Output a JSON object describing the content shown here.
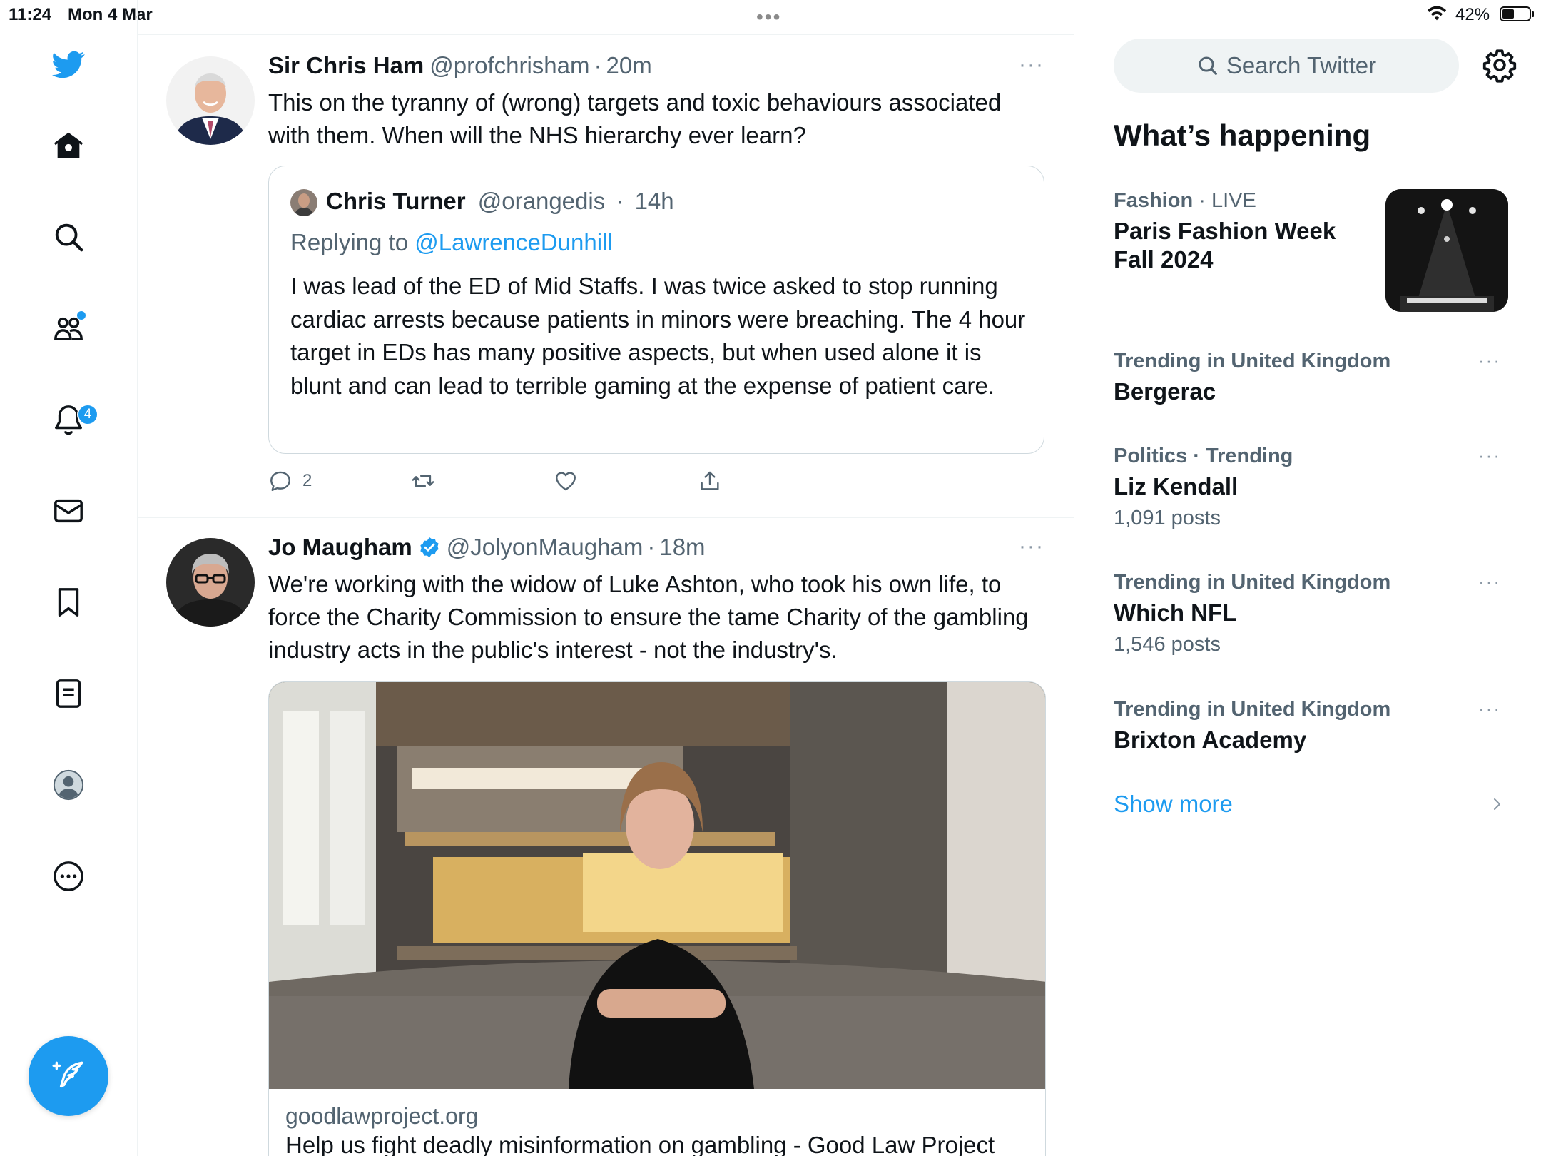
{
  "status_bar": {
    "time": "11:24",
    "date": "Mon 4 Mar",
    "battery_percent": "42%",
    "battery_level": 0.42
  },
  "nav": {
    "items": [
      {
        "name": "home",
        "icon": "home-icon"
      },
      {
        "name": "explore",
        "icon": "search-icon"
      },
      {
        "name": "communities",
        "icon": "communities-icon"
      },
      {
        "name": "notifications",
        "icon": "bell-icon"
      },
      {
        "name": "messages",
        "icon": "mail-icon"
      },
      {
        "name": "bookmarks",
        "icon": "bookmark-icon"
      },
      {
        "name": "lists",
        "icon": "list-icon"
      },
      {
        "name": "profile",
        "icon": "profile-icon"
      },
      {
        "name": "more",
        "icon": "more-circle-icon"
      }
    ],
    "notifications_badge": "4",
    "compose_icon": "compose-feather-icon"
  },
  "tweets": [
    {
      "name": "Sir Chris Ham",
      "handle": "@profchrisham",
      "sep": "·",
      "time": "20m",
      "more": "···",
      "text": "This on the tyranny of (wrong) targets and toxic behaviours associated with them. When will the NHS hierarchy ever learn?",
      "quote": {
        "name": "Chris Turner",
        "handle": "@orangedis",
        "sep": "·",
        "time": "14h",
        "replying_label": "Replying to",
        "replying_to": "@LawrenceDunhill",
        "text": "I was lead of the ED of Mid Staffs. I was twice asked to stop running cardiac arrests because patients in minors were breaching. The 4 hour target in EDs has many positive aspects, but when used alone it is blunt and can lead to terrible gaming at the expense of patient care."
      },
      "reply_count": "2"
    },
    {
      "name": "Jo Maugham",
      "handle": "@JolyonMaugham",
      "sep": "·",
      "time": "18m",
      "more": "···",
      "verified": true,
      "text": "We're working with the widow of Luke Ashton, who took his own life, to force the Charity Commission to ensure the tame Charity of the gambling industry acts in the public's interest - not the industry's.",
      "card": {
        "domain": "goodlawproject.org",
        "title": "Help us fight deadly misinformation on gambling - Good Law Project"
      }
    }
  ],
  "sidebar": {
    "search_placeholder": "Search Twitter",
    "whats_happening": "What’s happening",
    "trends": [
      {
        "category": "Fashion",
        "sep": "·",
        "status": "LIVE",
        "title": "Paris Fashion Week Fall 2024"
      },
      {
        "category": "Trending in United Kingdom",
        "title": "Bergerac",
        "more": "···"
      },
      {
        "category": "Politics",
        "sep": "·",
        "status": "Trending",
        "title": "Liz Kendall",
        "count": "1,091 posts",
        "more": "···"
      },
      {
        "category": "Trending in United Kingdom",
        "title": "Which NFL",
        "count": "1,546 posts",
        "more": "···"
      },
      {
        "category": "Trending in United Kingdom",
        "title": "Brixton Academy",
        "more": "···"
      }
    ],
    "show_more": "Show more"
  },
  "colors": {
    "accent": "#1d9bf0",
    "text_primary": "#0f1419",
    "text_secondary": "#536471",
    "border": "#cfd9de"
  }
}
